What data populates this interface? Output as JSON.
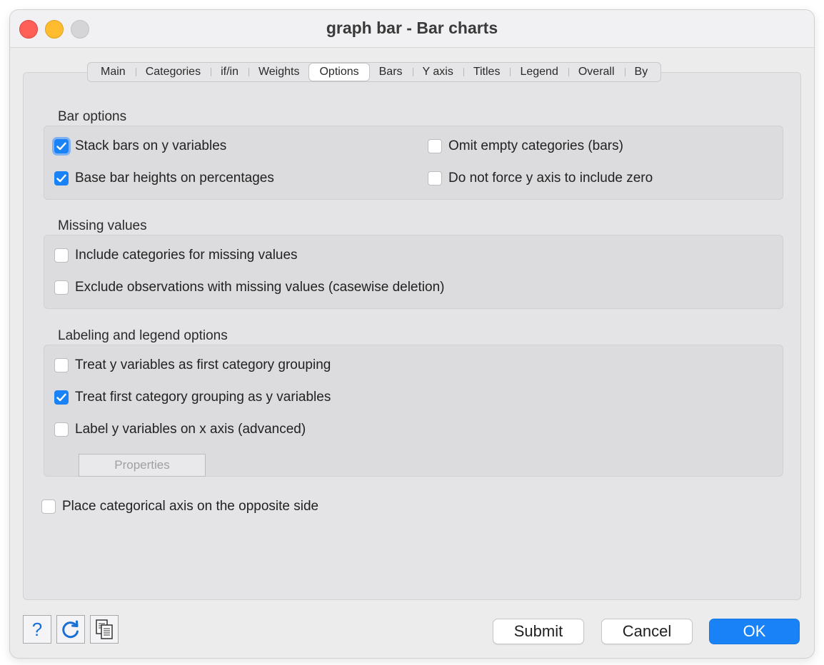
{
  "window": {
    "title": "graph bar - Bar charts"
  },
  "tabs": [
    {
      "label": "Main",
      "active": false
    },
    {
      "label": "Categories",
      "active": false
    },
    {
      "label": "if/in",
      "active": false
    },
    {
      "label": "Weights",
      "active": false
    },
    {
      "label": "Options",
      "active": true
    },
    {
      "label": "Bars",
      "active": false
    },
    {
      "label": "Y axis",
      "active": false
    },
    {
      "label": "Titles",
      "active": false
    },
    {
      "label": "Legend",
      "active": false
    },
    {
      "label": "Overall",
      "active": false
    },
    {
      "label": "By",
      "active": false
    }
  ],
  "bar_options": {
    "label": "Bar options",
    "stack_bars": {
      "label": "Stack bars on y variables",
      "checked": true
    },
    "omit_empty": {
      "label": "Omit empty categories (bars)",
      "checked": false
    },
    "percentages": {
      "label": "Base bar heights on percentages",
      "checked": true
    },
    "no_zero": {
      "label": "Do not force y axis to include zero",
      "checked": false
    }
  },
  "missing_values": {
    "label": "Missing values",
    "include_missing": {
      "label": "Include categories for missing values",
      "checked": false
    },
    "exclude_missing": {
      "label": "Exclude observations with missing values (casewise deletion)",
      "checked": false
    }
  },
  "labeling": {
    "label": "Labeling and legend options",
    "y_as_first": {
      "label": "Treat y variables as first category grouping",
      "checked": false
    },
    "first_as_y": {
      "label": "Treat first category grouping as y variables",
      "checked": true
    },
    "label_x": {
      "label": "Label y variables on x axis (advanced)",
      "checked": false
    },
    "properties_label": "Properties"
  },
  "opposite_side": {
    "label": "Place categorical axis on the opposite side",
    "checked": false
  },
  "footer": {
    "help_label": "?",
    "submit_label": "Submit",
    "cancel_label": "Cancel",
    "ok_label": "OK"
  },
  "colors": {
    "accent": "#1a82f7"
  }
}
